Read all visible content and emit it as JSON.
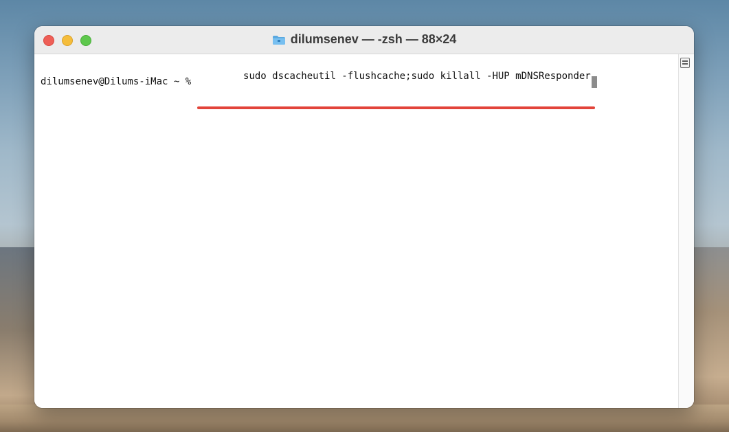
{
  "window": {
    "title": "dilumsenev — -zsh — 88×24"
  },
  "terminal": {
    "prompt": "dilumsenev@Dilums-iMac ~ % ",
    "command": "sudo dscacheutil -flushcache;sudo killall -HUP mDNSResponder"
  },
  "icons": {
    "title_icon": "folder-icon",
    "scroll_icon": "scroll-marker-icon"
  },
  "colors": {
    "close": "#ee5f57",
    "minimize": "#f5bd3b",
    "zoom": "#5ec84d",
    "highlight_underline": "#e2443a",
    "cursor": "#8c8c8c"
  }
}
